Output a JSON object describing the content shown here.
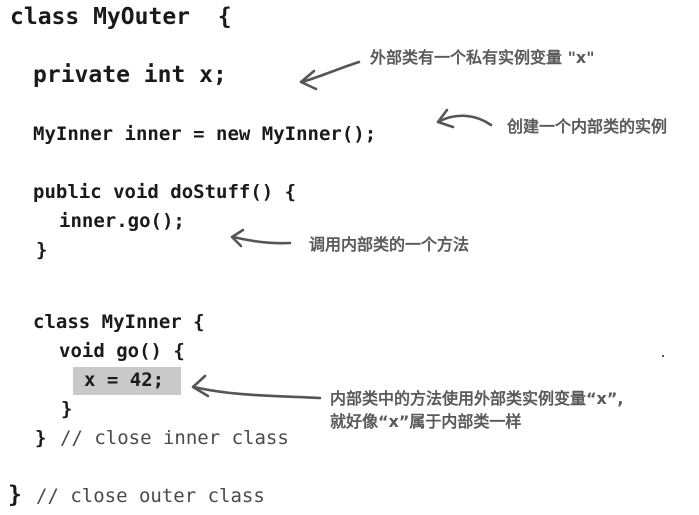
{
  "code": {
    "class_outer_decl": "class MyOuter  {",
    "private_field": "private int x;",
    "inner_field": "MyInner inner = new MyInner();",
    "do_stuff_decl": "public void doStuff() {",
    "inner_go_call": "inner.go();",
    "do_stuff_close": "}",
    "class_inner_decl": "class MyInner {",
    "go_decl": "void go() {",
    "assign_x": "x = 42;",
    "go_close": "}",
    "inner_close_brace": "}",
    "inner_close_comment": "// close inner class",
    "outer_close_brace": "}",
    "outer_close_comment": "// close outer class"
  },
  "annotations": {
    "private_var_note": "外部类有一个私有实例变量 \"x\"",
    "create_instance_note": "创建一个内部类的实例",
    "call_method_note": "调用内部类的一个方法",
    "use_var_note_line1": "内部类中的方法使用外部类实例变量“x”,",
    "use_var_note_line2": "就好像“x”属于内部类一样"
  },
  "colors": {
    "code_text": "#1a1a1a",
    "comment_text": "#4a4a4a",
    "annotation_text": "#5a5a5a",
    "arrow": "#555555",
    "highlight": "#c9c9c9"
  }
}
